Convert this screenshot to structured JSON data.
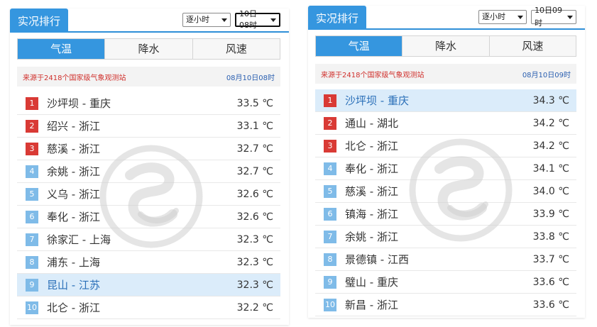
{
  "panels": [
    {
      "title": "实况排行",
      "select_interval": "逐小时",
      "select_time": "10日08时",
      "tabs": [
        "气温",
        "降水",
        "风速"
      ],
      "source": "来源于2418个国家级气象观测站",
      "timestamp": "08月10日08时",
      "rows": [
        {
          "rank": "1",
          "station": "沙坪坝 - 重庆",
          "temp": "33.5 ℃"
        },
        {
          "rank": "2",
          "station": "绍兴 - 浙江",
          "temp": "33.1 ℃"
        },
        {
          "rank": "3",
          "station": "慈溪 - 浙江",
          "temp": "32.7 ℃"
        },
        {
          "rank": "4",
          "station": "余姚 - 浙江",
          "temp": "32.7 ℃"
        },
        {
          "rank": "5",
          "station": "义乌 - 浙江",
          "temp": "32.6 ℃"
        },
        {
          "rank": "6",
          "station": "奉化 - 浙江",
          "temp": "32.6 ℃"
        },
        {
          "rank": "7",
          "station": "徐家汇 - 上海",
          "temp": "32.3 ℃"
        },
        {
          "rank": "8",
          "station": "浦东 - 上海",
          "temp": "32.3 ℃"
        },
        {
          "rank": "9",
          "station": "昆山 - 江苏",
          "temp": "32.3 ℃"
        },
        {
          "rank": "10",
          "station": "北仑 - 浙江",
          "temp": "32.2 ℃"
        }
      ]
    },
    {
      "title": "实况排行",
      "select_interval": "逐小时",
      "select_time": "10日09时",
      "tabs": [
        "气温",
        "降水",
        "风速"
      ],
      "source": "来源于2418个国家级气象观测站",
      "timestamp": "08月10日09时",
      "rows": [
        {
          "rank": "1",
          "station": "沙坪坝 - 重庆",
          "temp": "34.3 ℃"
        },
        {
          "rank": "2",
          "station": "通山 - 湖北",
          "temp": "34.2 ℃"
        },
        {
          "rank": "3",
          "station": "北仑 - 浙江",
          "temp": "34.2 ℃"
        },
        {
          "rank": "4",
          "station": "奉化 - 浙江",
          "temp": "34.1 ℃"
        },
        {
          "rank": "5",
          "station": "慈溪 - 浙江",
          "temp": "34.0 ℃"
        },
        {
          "rank": "6",
          "station": "镇海 - 浙江",
          "temp": "33.9 ℃"
        },
        {
          "rank": "7",
          "station": "余姚 - 浙江",
          "temp": "33.8 ℃"
        },
        {
          "rank": "8",
          "station": "景德镇 - 江西",
          "temp": "33.7 ℃"
        },
        {
          "rank": "9",
          "station": "璧山 - 重庆",
          "temp": "33.6 ℃"
        },
        {
          "rank": "10",
          "station": "新昌 - 浙江",
          "temp": "33.6 ℃"
        }
      ]
    }
  ],
  "colors": {
    "accent": "#3596df",
    "rank_top": "#d93a35",
    "rank_rest": "#7fbbe8",
    "highlight_row": "#dbecfa",
    "source_text": "#d0312d",
    "timestamp_text": "#2a5fb0"
  },
  "icons": {
    "watermark": "weather-logo-icon",
    "dropdown": "caret-down-icon"
  }
}
